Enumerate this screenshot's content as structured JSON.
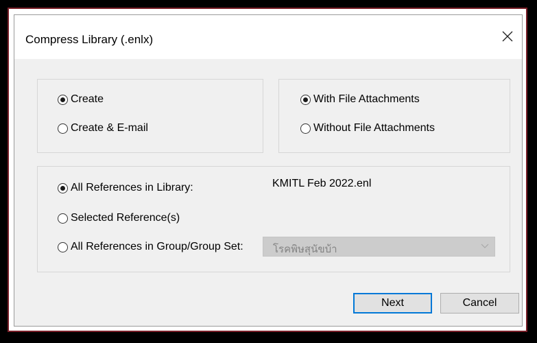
{
  "dialog": {
    "title": "Compress Library (.enlx)",
    "close_icon": "close-icon"
  },
  "action_group": {
    "options": [
      {
        "label": "Create",
        "checked": true
      },
      {
        "label": "Create & E-mail",
        "checked": false
      }
    ]
  },
  "attachment_group": {
    "options": [
      {
        "label": "With File Attachments",
        "checked": true
      },
      {
        "label": "Without File Attachments",
        "checked": false
      }
    ]
  },
  "references_group": {
    "options": [
      {
        "label": "All References in Library:",
        "checked": true
      },
      {
        "label": "Selected Reference(s)",
        "checked": false
      },
      {
        "label": "All References in Group/Group Set:",
        "checked": false
      }
    ],
    "library_name": "KMITL Feb 2022.enl",
    "group_select": {
      "value": "โรคพิษสุนัขบ้า",
      "disabled": true,
      "arrow_icon": "chevron-down-icon"
    }
  },
  "buttons": {
    "next_label": "Next",
    "cancel_label": "Cancel"
  },
  "colors": {
    "accent": "#0078d7",
    "frame_border": "#7a1f28",
    "dialog_background": "#f0f0f0"
  }
}
